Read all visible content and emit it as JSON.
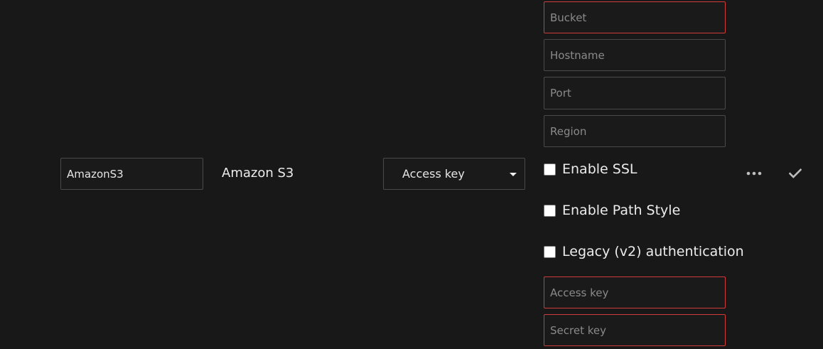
{
  "remote": {
    "name_value": "AmazonS3",
    "provider_label": "Amazon S3",
    "auth_select": {
      "selected": "Access key"
    }
  },
  "fields": {
    "bucket_placeholder": "Bucket",
    "hostname_placeholder": "Hostname",
    "port_placeholder": "Port",
    "region_placeholder": "Region",
    "access_key_placeholder": "Access key",
    "secret_key_placeholder": "Secret key"
  },
  "options": {
    "enable_ssl_label": "Enable SSL",
    "enable_path_style_label": "Enable Path Style",
    "legacy_auth_label": "Legacy (v2) authentication"
  },
  "actions": {
    "more_icon": "more-horizontal-icon",
    "confirm_icon": "checkmark-icon"
  },
  "colors": {
    "background": "#181818",
    "required_border": "#d23b3b",
    "border": "#4a4a4a"
  }
}
